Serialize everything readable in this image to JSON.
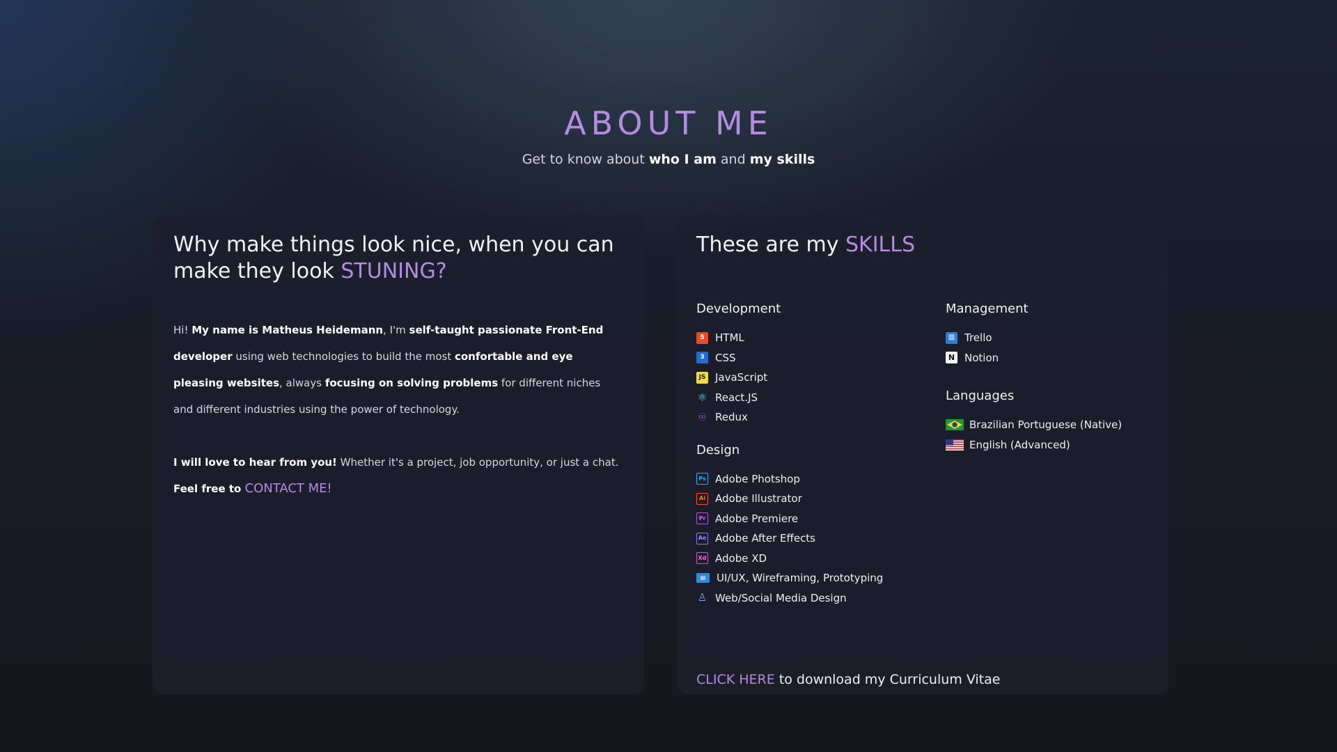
{
  "header": {
    "title": "ABOUT ME",
    "subtitle_pre": "Get to know about ",
    "subtitle_b1": "who I am",
    "subtitle_mid": " and ",
    "subtitle_b2": "my skills"
  },
  "about": {
    "heading_pre": "Why make things look nice, when you can make they look ",
    "heading_accent": "STUNING?",
    "p1": [
      {
        "t": "Hi! ",
        "b": false
      },
      {
        "t": "My name is Matheus Heidemann",
        "b": true
      },
      {
        "t": ", I'm ",
        "b": false
      },
      {
        "t": "self-taught passionate Front-End developer",
        "b": true
      },
      {
        "t": " using web technologies to build the most ",
        "b": false
      },
      {
        "t": "confortable and eye pleasing websites",
        "b": true
      },
      {
        "t": ", always ",
        "b": false
      },
      {
        "t": "focusing on solving problems",
        "b": true
      },
      {
        "t": " for different niches and different industries using the power of technology.",
        "b": false
      }
    ],
    "p2_b1": "I will love to hear from you!",
    "p2_mid": " Whether it's a project, job opportunity, or just a chat. ",
    "p2_b2": "Feel free to ",
    "contact_label": "CONTACT ME!"
  },
  "skills": {
    "heading_pre": "These are my ",
    "heading_accent": "SKILLS",
    "development": {
      "title": "Development",
      "items": [
        {
          "label": "HTML",
          "icon": "html5-icon"
        },
        {
          "label": "CSS",
          "icon": "css3-icon"
        },
        {
          "label": "JavaScript",
          "icon": "javascript-icon"
        },
        {
          "label": "React.JS",
          "icon": "react-icon"
        },
        {
          "label": "Redux",
          "icon": "redux-icon"
        }
      ]
    },
    "design": {
      "title": "Design",
      "items": [
        {
          "label": "Adobe Photshop",
          "icon": "photoshop-icon"
        },
        {
          "label": "Adobe Illustrator",
          "icon": "illustrator-icon"
        },
        {
          "label": "Adobe Premiere",
          "icon": "premiere-icon"
        },
        {
          "label": "Adobe After Effects",
          "icon": "after-effects-icon"
        },
        {
          "label": "Adobe XD",
          "icon": "adobe-xd-icon"
        },
        {
          "label": "UI/UX, Wireframing, Prototyping",
          "icon": "uiux-icon"
        },
        {
          "label": "Web/Social Media Design",
          "icon": "web-design-icon"
        }
      ]
    },
    "management": {
      "title": "Management",
      "items": [
        {
          "label": "Trello",
          "icon": "trello-icon"
        },
        {
          "label": "Notion",
          "icon": "notion-icon"
        }
      ]
    },
    "languages": {
      "title": "Languages",
      "items": [
        {
          "label": "Brazilian Portuguese (Native)",
          "icon": "brazil-flag-icon"
        },
        {
          "label": "English (Advanced)",
          "icon": "usa-flag-icon"
        }
      ]
    },
    "cv_link": "CLICK HERE",
    "cv_text": " to download my Curriculum Vitae"
  },
  "colors": {
    "accent": "#b48ce0",
    "background": "#171a24",
    "card": "#1c1f2c"
  }
}
